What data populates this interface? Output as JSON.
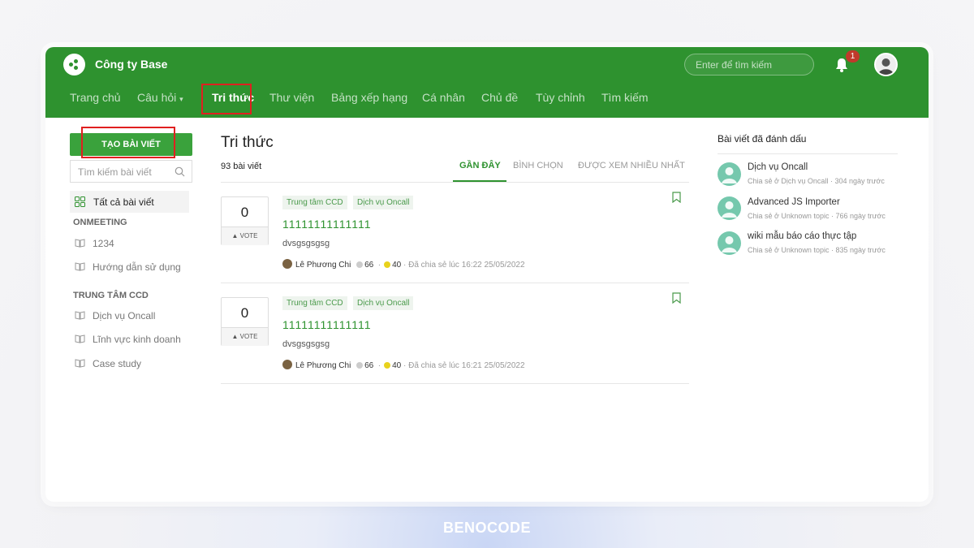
{
  "header": {
    "company": "Công ty Base",
    "search_placeholder": "Enter để tìm kiếm",
    "notification_count": "1"
  },
  "nav": {
    "items": [
      "Trang chủ",
      "Câu hỏi",
      "Tri thức",
      "Thư viện",
      "Bảng xếp hạng",
      "Cá nhân",
      "Chủ đề",
      "Tùy chỉnh",
      "Tìm kiếm"
    ],
    "active": "Tri thức"
  },
  "sidebar": {
    "create_button": "TẠO BÀI VIẾT",
    "search_placeholder": "Tìm kiếm bài viết",
    "all_posts": "Tất cả bài viết",
    "groups": [
      {
        "heading": "ONMEETING",
        "items": [
          "1234",
          "Hướng dẫn sử dụng"
        ]
      },
      {
        "heading": "TRUNG TÂM CCD",
        "items": [
          "Dịch vụ Oncall",
          "Lĩnh vực kinh doanh",
          "Case study"
        ]
      }
    ]
  },
  "main": {
    "title": "Tri thức",
    "count": "93 bài viết",
    "tabs": [
      "GẦN ĐÂY",
      "BÌNH CHỌN",
      "ĐƯỢC XEM NHIỀU NHẤT"
    ],
    "posts": [
      {
        "votes": "0",
        "vote_label": "VOTE",
        "tags": [
          "Trung tâm CCD",
          "Dịch vụ Oncall"
        ],
        "title": "11111111111111",
        "excerpt": "dvsgsgsgsg",
        "author": "Lê Phương Chi",
        "score_gray": "66",
        "score_gold": "40",
        "shared": "· Đã chia sẻ lúc 16:22 25/05/2022"
      },
      {
        "votes": "0",
        "vote_label": "VOTE",
        "tags": [
          "Trung tâm CCD",
          "Dịch vụ Oncall"
        ],
        "title": "11111111111111",
        "excerpt": "dvsgsgsgsg",
        "author": "Lê Phương Chi",
        "score_gray": "66",
        "score_gold": "40",
        "shared": "· Đã chia sẻ lúc 16:21 25/05/2022"
      }
    ]
  },
  "bookmarks": {
    "title": "Bài viết đã đánh dấu",
    "items": [
      {
        "title": "Dịch vụ Oncall",
        "sub": "Chia sẻ ở Dịch vụ Oncall · 304 ngày trước"
      },
      {
        "title": "Advanced JS Importer",
        "sub": "Chia sẻ ở Unknown topic · 766 ngày trước"
      },
      {
        "title": "wiki mẫu báo cáo thực tập",
        "sub": "Chia sẻ ở Unknown topic · 835 ngày trước"
      }
    ]
  },
  "footer_brand": "BENOCODE",
  "colors": {
    "primary": "#2e922f",
    "highlight": "#e02020"
  }
}
